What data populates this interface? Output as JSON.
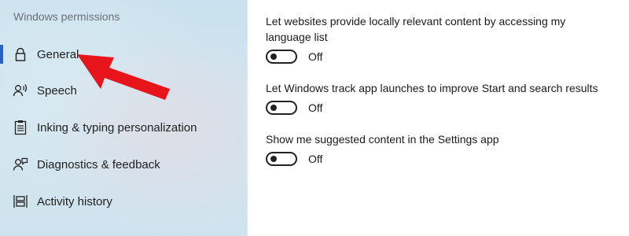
{
  "sidebar": {
    "title": "Windows permissions",
    "items": [
      {
        "label": "General",
        "icon": "lock-icon",
        "selected": true
      },
      {
        "label": "Speech",
        "icon": "speech-icon",
        "selected": false
      },
      {
        "label": "Inking & typing personalization",
        "icon": "clipboard-icon",
        "selected": false
      },
      {
        "label": "Diagnostics & feedback",
        "icon": "feedback-icon",
        "selected": false
      },
      {
        "label": "Activity history",
        "icon": "activity-icon",
        "selected": false
      }
    ]
  },
  "settings": [
    {
      "description": "Let websites provide locally relevant content by accessing my language list",
      "state": "Off"
    },
    {
      "description": "Let Windows track app launches to improve Start and search results",
      "state": "Off"
    },
    {
      "description": "Show me suggested content in the Settings app",
      "state": "Off"
    }
  ],
  "colors": {
    "accent": "#2a63c6",
    "annotation_arrow": "#e8141c"
  }
}
